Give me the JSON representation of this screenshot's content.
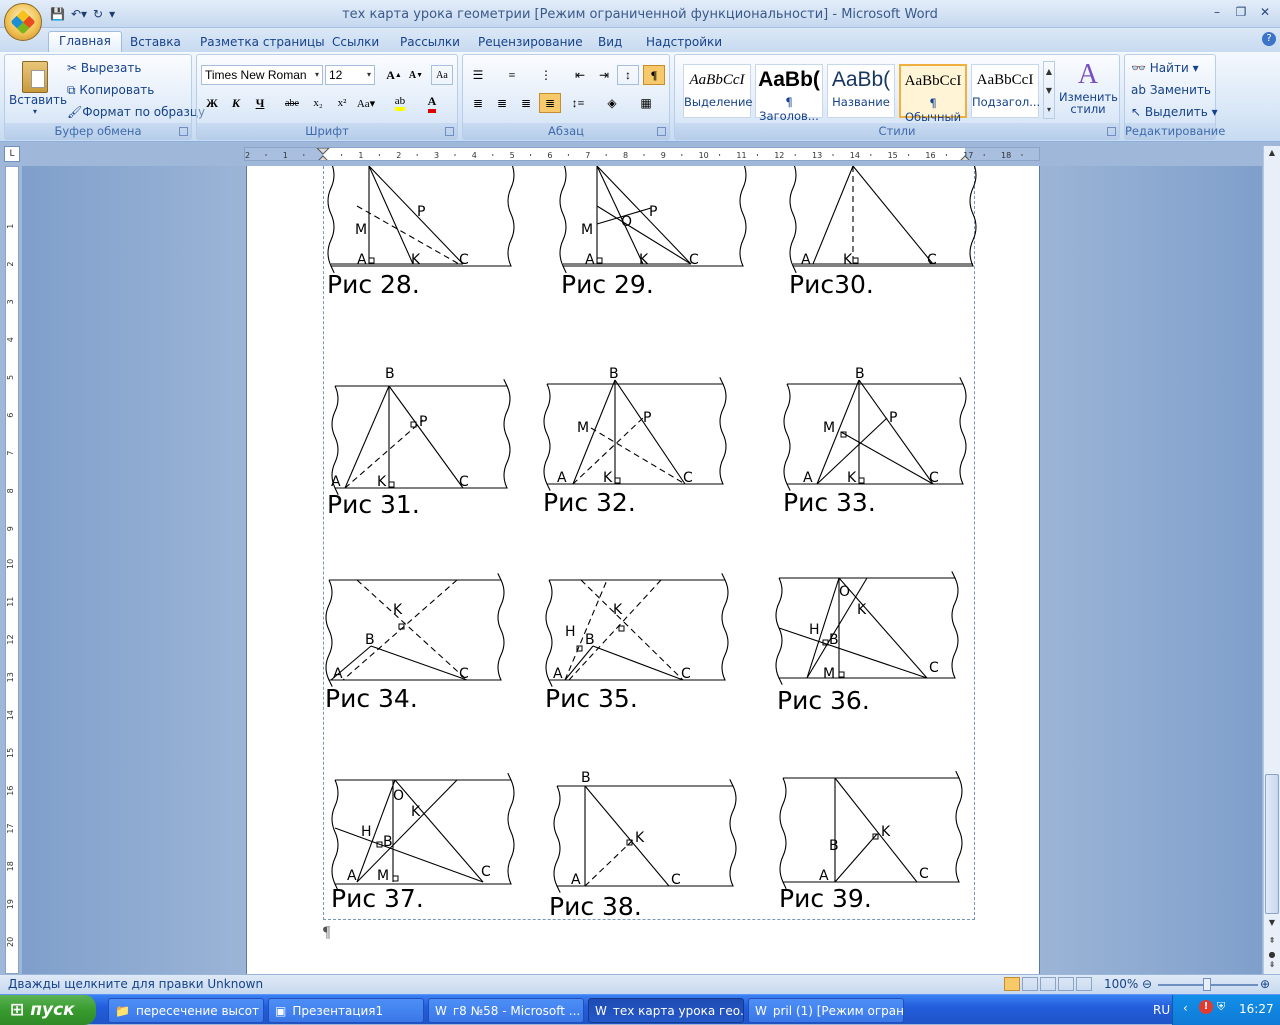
{
  "window": {
    "title": "тех карта урока геометрии [Режим ограниченной функциональности] - Microsoft Word"
  },
  "tabs": [
    "Главная",
    "Вставка",
    "Разметка страницы",
    "Ссылки",
    "Рассылки",
    "Рецензирование",
    "Вид",
    "Надстройки"
  ],
  "clipboard": {
    "paste": "Вставить",
    "cut": "Вырезать",
    "copy": "Копировать",
    "format_painter": "Формат по образцу",
    "label": "Буфер обмена"
  },
  "font": {
    "name": "Times New Roman",
    "size": "12",
    "label": "Шрифт"
  },
  "paragraph": {
    "label": "Абзац"
  },
  "styles": {
    "items": [
      {
        "preview": "AaBbCcI",
        "name": "Выделение"
      },
      {
        "preview": "AaBb(",
        "name": "¶ Заголов..."
      },
      {
        "preview": "AaBb(",
        "name": "Название"
      },
      {
        "preview": "AaBbCcI",
        "name": "¶ Обычный"
      },
      {
        "preview": "AaBbCcI",
        "name": "Подзагол..."
      }
    ],
    "change": "Изменить стили",
    "label": "Стили"
  },
  "editing": {
    "find": "Найти",
    "replace": "Заменить",
    "select": "Выделить",
    "label": "Редактирование"
  },
  "captions": [
    "Рис 28.",
    "Рис 29.",
    "Рис30.",
    "Рис 31.",
    "Рис 32.",
    "Рис 33.",
    "Рис 34.",
    "Рис 35.",
    "Рис 36.",
    "Рис 37.",
    "Рис 38.",
    "Рис 39."
  ],
  "pilcrow": "¶",
  "status": {
    "left": "Дважды щелкните для правки Unknown",
    "zoom": "100%"
  },
  "taskbar": {
    "start": "пуск",
    "items": [
      "пересечение высот",
      "Презентация1",
      "г8 №58 - Microsoft ...",
      "тех карта урока гео...",
      "pril (1) [Режим огран..."
    ],
    "lang": "RU",
    "time": "16:27"
  },
  "colors": {
    "word_blue": "#15428b",
    "taskbar": "#245edc",
    "start_green": "#389b2e"
  }
}
